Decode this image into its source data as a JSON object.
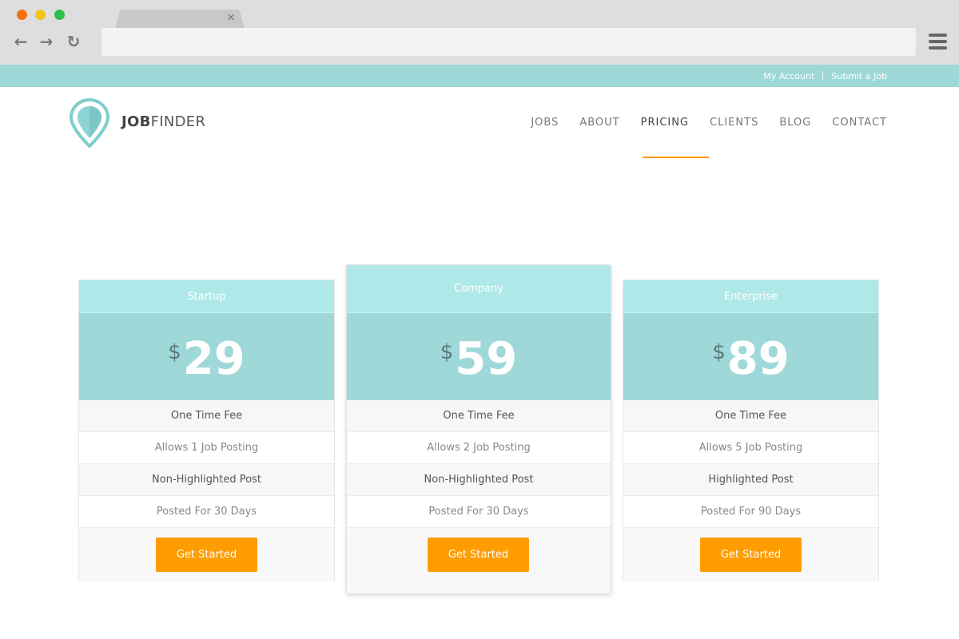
{
  "browser": {
    "tab_close": "×",
    "back": "←",
    "forward": "→",
    "reload": "↻"
  },
  "topbar": {
    "links": [
      "My Account",
      "Submit a Job"
    ]
  },
  "brand": {
    "bold": "JOB",
    "rest": "FINDER"
  },
  "nav": {
    "items": [
      "JOBS",
      "ABOUT",
      "PRICING",
      "CLIENTS",
      "BLOG",
      "CONTACT"
    ],
    "active": "PRICING"
  },
  "plans": [
    {
      "name": "Startup",
      "currency": "$",
      "price": "29",
      "features": [
        "One Time Fee",
        "Allows 1 Job Posting",
        "Non-Highlighted Post",
        "Posted For 30 Days"
      ],
      "cta": "Get Started"
    },
    {
      "name": "Company",
      "currency": "$",
      "price": "59",
      "features": [
        "One Time Fee",
        "Allows 2 Job Posting",
        "Non-Highlighted Post",
        "Posted For 30 Days"
      ],
      "cta": "Get Started"
    },
    {
      "name": "Enterprise",
      "currency": "$",
      "price": "89",
      "features": [
        "One Time Fee",
        "Allows 5 Job Posting",
        "Highlighted Post",
        "Posted For 90 Days"
      ],
      "cta": "Get Started"
    }
  ],
  "colors": {
    "accent": "#ff9c00",
    "teal": "#9ed8d8",
    "teal_light": "#afe8e8"
  }
}
